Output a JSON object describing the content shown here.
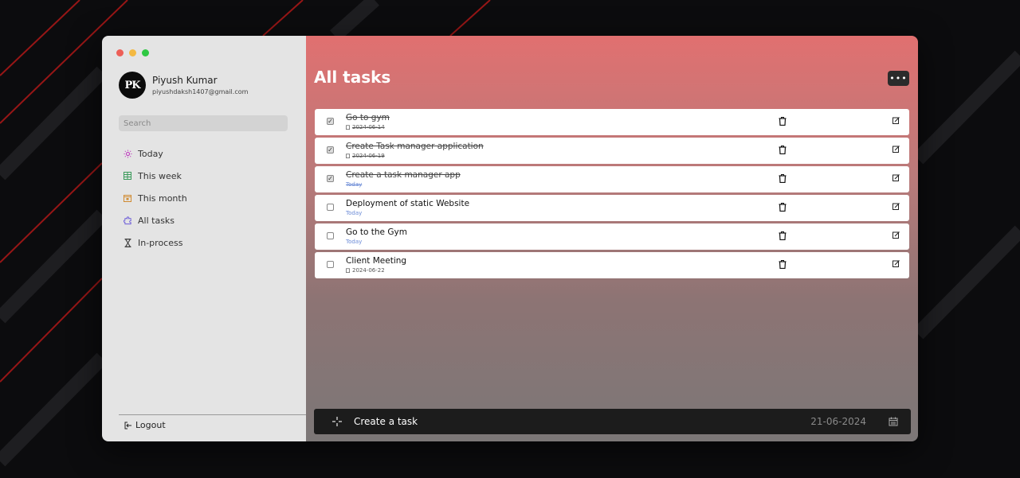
{
  "profile": {
    "avatar_text": "PK",
    "name": "Piyush Kumar",
    "email": "piyushdaksh1407@gmail.com"
  },
  "search": {
    "placeholder": "Search"
  },
  "sidebar": {
    "items": [
      {
        "label": "Today",
        "icon": "sun-icon",
        "color": "#c040c0"
      },
      {
        "label": "This week",
        "icon": "grid-icon",
        "color": "#3a9a5a"
      },
      {
        "label": "This month",
        "icon": "calendar-icon",
        "color": "#d08a30"
      },
      {
        "label": "All tasks",
        "icon": "puzzle-icon",
        "color": "#6a5ad8"
      },
      {
        "label": "In-process",
        "icon": "hourglass-icon",
        "color": "#333333"
      }
    ],
    "logout_label": "Logout"
  },
  "main": {
    "title": "All tasks",
    "menu_label": "•••"
  },
  "tasks": [
    {
      "name": "Go to gym",
      "date": "2024-06-14",
      "done": true,
      "today": false
    },
    {
      "name": "Create Task manager application",
      "date": "2024-06-19",
      "done": true,
      "today": false
    },
    {
      "name": "Create a task manager app",
      "date": "Today",
      "done": true,
      "today": true
    },
    {
      "name": "Deployment of static Website",
      "date": "Today",
      "done": false,
      "today": true
    },
    {
      "name": "Go to the Gym",
      "date": "Today",
      "done": false,
      "today": true
    },
    {
      "name": "Client Meeting",
      "date": "2024-06-22",
      "done": false,
      "today": false
    }
  ],
  "create": {
    "placeholder": "Create a task",
    "date": "21-06-2024"
  },
  "colors": {
    "close": "#ed5f57",
    "minimize": "#f4b942",
    "maximize": "#2fc843"
  }
}
